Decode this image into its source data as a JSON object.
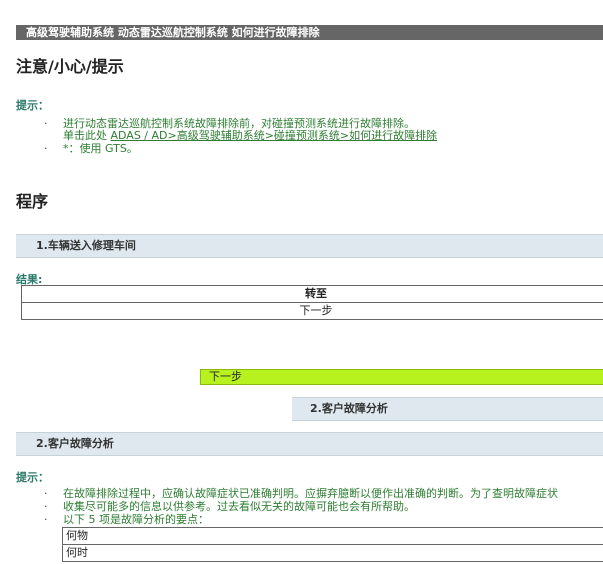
{
  "breadcrumb": "高级驾驶辅助系统  动态雷达巡航控制系统  如何进行故障排除",
  "page_title": "注意/小心/提示",
  "tip1": {
    "label": "提示：",
    "line1": "进行动态雷达巡航控制系统故障排除前，对碰撞预测系统进行故障排除。",
    "line2_prefix": "单击此处 ",
    "line2_link": "ADAS / AD>高级驾驶辅助系统>碰撞预测系统>如何进行故障排除",
    "line3": "*：使用 GTS。",
    "bullet": "·"
  },
  "procedure_title": "程序",
  "step1": {
    "title": "1.车辆送入修理车间",
    "result_label": "结果:",
    "table_header": "转至",
    "table_value": "下一步"
  },
  "next_step_label": "下一步",
  "step2_nav_label": "2.客户故障分析",
  "step2": {
    "title": "2.客户故障分析",
    "tip_label": "提示：",
    "bullets": [
      "在故障排除过程中，应确认故障症状已准确判明。应摒弃臆断以便作出准确的判断。为了查明故障症状",
      "收集尽可能多的信息以供参考。过去看似无关的故障可能也会有所帮助。",
      "以下 5 项是故障分析的要点："
    ],
    "points": [
      "何物",
      "何时"
    ]
  }
}
